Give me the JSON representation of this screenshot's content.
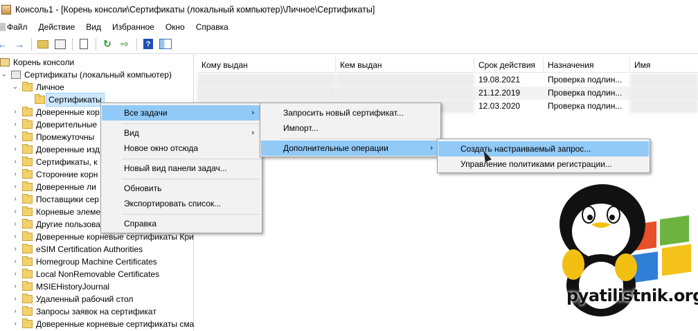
{
  "window": {
    "title": "Консоль1 - [Корень консоли\\Сертификаты (локальный компьютер)\\Личное\\Сертификаты]"
  },
  "menubar": {
    "items": [
      "Файл",
      "Действие",
      "Вид",
      "Избранное",
      "Окно",
      "Справка"
    ]
  },
  "toolbar": {
    "icons": [
      "back-arrow-icon",
      "forward-arrow-icon",
      "up-folder-icon",
      "show-hide-tree-icon",
      "properties-icon",
      "refresh-icon",
      "export-list-icon",
      "help-icon",
      "action-pane-icon"
    ]
  },
  "tree": {
    "root": "Корень консоли",
    "certs_root": "Сертификаты (локальный компьютер)",
    "personal": "Личное",
    "certificates": "Сертификаты",
    "stores": [
      "Доверенные кор",
      "Доверительные",
      "Промежуточны",
      "Доверенные изд",
      "Сертификаты, к",
      "Сторонние корн",
      "Доверенные ли",
      "Поставщики сер",
      "Корневые элеме",
      "Другие пользова",
      "Доверенные корневые сертификаты Кри",
      "eSIM Certification Authorities",
      "Homegroup Machine Certificates",
      "Local NonRemovable Certificates",
      "MSIEHistoryJournal",
      "Удаленный рабочий стол",
      "Запросы заявок на сертификат",
      "Доверенные корневые сертификаты сма"
    ]
  },
  "list": {
    "columns": [
      "Кому выдан",
      "Кем выдан",
      "Срок действия",
      "Назначения",
      "Имя"
    ],
    "rows": [
      {
        "expires": "19.08.2021",
        "purpose": "Проверка подлин..."
      },
      {
        "expires": "21.12.2019",
        "purpose": "Проверка подлин..."
      },
      {
        "expires": "12.03.2020",
        "purpose": "Проверка подлин..."
      }
    ]
  },
  "context_menu": {
    "items": [
      {
        "label": "Все задачи",
        "submenu": true,
        "highlighted": true
      },
      {
        "label": "Вид",
        "submenu": true
      },
      {
        "label": "Новое окно отсюда"
      },
      {
        "label": "Новый вид панели задач..."
      },
      {
        "label": "Обновить"
      },
      {
        "label": "Экспортировать список..."
      },
      {
        "label": "Справка"
      }
    ]
  },
  "submenu_tasks": {
    "items": [
      {
        "label": "Запросить новый сертификат..."
      },
      {
        "label": "Импорт..."
      },
      {
        "label": "Дополнительные операции",
        "submenu": true,
        "highlighted": true
      }
    ]
  },
  "submenu_advanced": {
    "items": [
      {
        "label": "Создать настраиваемый запрос...",
        "highlighted": true
      },
      {
        "label": "Управление политиками регистрации..."
      }
    ]
  },
  "watermark": {
    "text": "pyatilistnik.org"
  },
  "colors": {
    "menu_highlight": "#91c9f7",
    "tree_selected": "#cce8ff",
    "menu_bg": "#f2f2f2"
  }
}
